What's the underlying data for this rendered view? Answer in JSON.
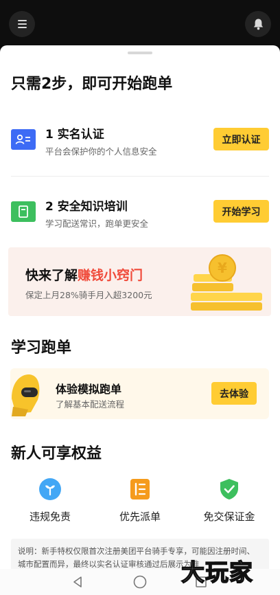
{
  "header": {
    "menu_icon": "menu-icon",
    "bell_icon": "bell-icon"
  },
  "onboarding": {
    "title": "只需2步，即可开始跑单",
    "steps": [
      {
        "title": "1 实名认证",
        "subtitle": "平台会保护你的个人信息安全",
        "button": "立即认证",
        "icon": "id-card-icon",
        "icon_color": "#3d6bf5"
      },
      {
        "title": "2 安全知识培训",
        "subtitle": "学习配送常识，跑单更安全",
        "button": "开始学习",
        "icon": "training-book-icon",
        "icon_color": "#3dbf5e"
      }
    ]
  },
  "promo": {
    "title_prefix": "快来了解",
    "title_highlight": "赚钱小窍门",
    "subtitle": "保定上月28%骑手月入超3200元",
    "highlight_color": "#f04a3a"
  },
  "learn": {
    "title": "学习跑单",
    "card_title": "体验模拟跑单",
    "card_subtitle": "了解基本配送流程",
    "button": "去体验"
  },
  "benefits": {
    "title": "新人可享权益",
    "items": [
      {
        "label": "违规免责",
        "icon": "sprout-icon",
        "color": "#43a7f5"
      },
      {
        "label": "优先派单",
        "icon": "priority-order-icon",
        "color": "#f59b1c"
      },
      {
        "label": "免交保证金",
        "icon": "shield-check-icon",
        "color": "#3dbf5e"
      }
    ]
  },
  "note": {
    "text": "说明：新手特权仅限首次注册美团平台骑手专享，可能因注册时间、城市配置而异，最终以实名认证审核通过后展示为准"
  },
  "navbar": {
    "back": "back-icon",
    "home": "home-icon",
    "recents": "recents-icon"
  },
  "watermark": "大玩家",
  "colors": {
    "accent_yellow": "#ffcc33",
    "brand_blue": "#3d6bf5",
    "brand_green": "#3dbf5e"
  }
}
